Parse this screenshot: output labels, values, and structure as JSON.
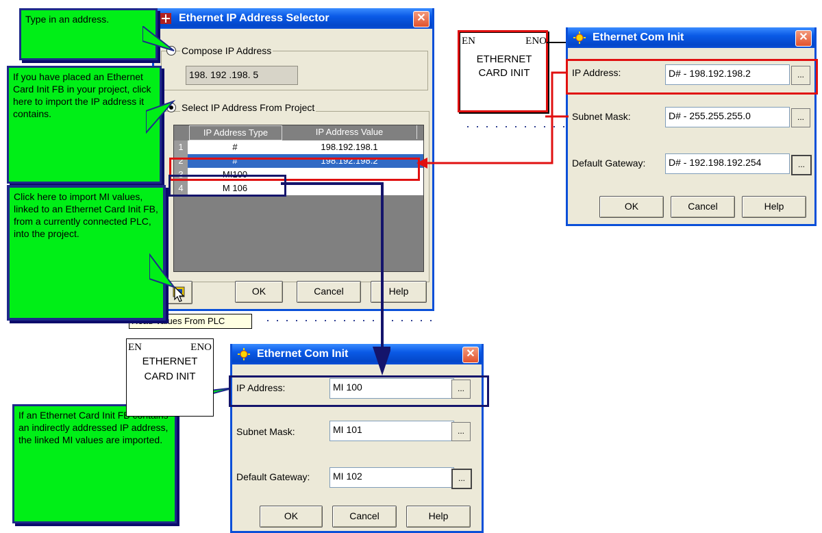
{
  "callouts": {
    "type_address": "Type in an address.",
    "select_project": "If you have placed an Ethernet Card Init FB in your project, click here to import the IP address it contains.",
    "import_mi": "Click here to import MI values, linked to an Ethernet Card Init FB, from a currently connected PLC, into the project.",
    "indirect": "If an Ethernet  Card Init FB contains an indirectly addressed IP address, the  linked MI values are imported."
  },
  "selector": {
    "title": "Ethernet IP Address Selector",
    "compose_label": "Compose IP Address",
    "compose_value": "198. 192 .198.  5",
    "select_label": "Select IP Address From Project",
    "col_type": "IP Address Type",
    "col_value": "IP Address Value",
    "rows": [
      {
        "num": "1",
        "type": "#",
        "value": "198.192.198.1"
      },
      {
        "num": "2",
        "type": "#",
        "value": "198.192.198.2"
      },
      {
        "num": "3",
        "type": "MI100",
        "value": ""
      },
      {
        "num": "4",
        "type": "M 106",
        "value": ""
      }
    ],
    "ok": "OK",
    "cancel": "Cancel",
    "help": "Help",
    "tooltip": "Read Values From PLC"
  },
  "fb_top": {
    "en": "EN",
    "eno": "ENO",
    "name_line1": "ETHERNET",
    "name_line2": "CARD INIT"
  },
  "fb_bottom": {
    "en": "EN",
    "eno": "ENO",
    "name_line1": "ETHERNET",
    "name_line2": "CARD INIT"
  },
  "com_top": {
    "title": "Ethernet Com Init",
    "ip_label": "IP Address:",
    "ip_value": "D# - 198.192.198.2",
    "subnet_label": "Subnet Mask:",
    "subnet_value": "D# - 255.255.255.0",
    "gateway_label": "Default Gateway:",
    "gateway_value": "D# - 192.198.192.254",
    "dots": "...",
    "ok": "OK",
    "cancel": "Cancel",
    "help": "Help"
  },
  "com_bottom": {
    "title": "Ethernet Com Init",
    "ip_label": "IP Address:",
    "ip_value": "MI 100",
    "subnet_label": "Subnet Mask:",
    "subnet_value": "MI 101",
    "gateway_label": "Default Gateway:",
    "gateway_value": "MI 102",
    "dots": "...",
    "ok": "OK",
    "cancel": "Cancel",
    "help": "Help"
  },
  "colors": {
    "callout": "#00ef17",
    "highlight_red": "#e01010",
    "highlight_blue": "#14146b",
    "title_blue": "#0a4fd8"
  }
}
